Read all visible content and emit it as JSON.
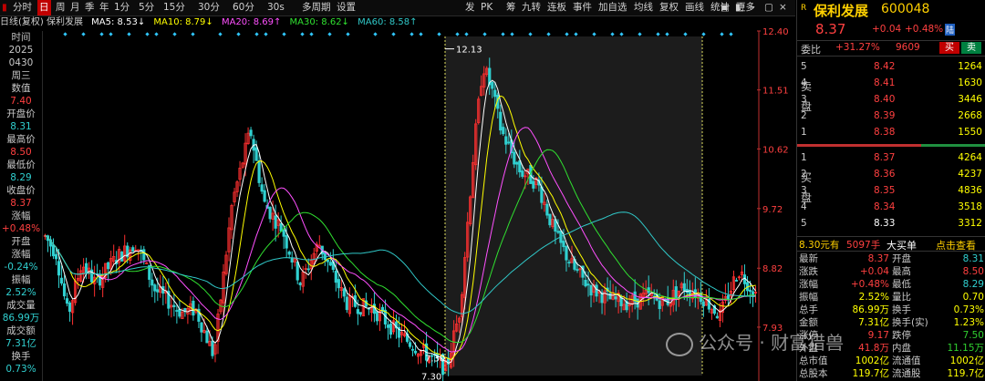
{
  "toolbar": {
    "tabs": [
      "分时",
      "日",
      "周",
      "月",
      "季",
      "年",
      "1分",
      "5分",
      "15分",
      "30分",
      "60分",
      "30s",
      "多周期",
      "设置"
    ],
    "active_tab": "日",
    "right_items": [
      "发",
      "PK",
      "筹",
      "九转",
      "连板",
      "事件",
      "加自选",
      "均线",
      "复权",
      "画线",
      "统计",
      "更多"
    ]
  },
  "info": {
    "stock_name": "日线(复权) 保利发展",
    "ma5": "MA5: 8.53↓",
    "ma10": "MA10: 8.79↓",
    "ma20": "MA20: 8.69↑",
    "ma30": "MA30: 8.62↓",
    "ma60": "MA60: 8.58↑"
  },
  "left_panel": [
    {
      "label": "时间",
      "color": "#c8c8c8"
    },
    {
      "label": "2025",
      "color": "#c8c8c8"
    },
    {
      "label": "0430",
      "color": "#c8c8c8"
    },
    {
      "label": "周三",
      "color": "#c8c8c8"
    },
    {
      "label": "数值",
      "color": "#c8c8c8"
    },
    {
      "label": "7.40",
      "color": "#ff4040"
    },
    {
      "label": "开盘价",
      "color": "#c8c8c8"
    },
    {
      "label": "8.31",
      "color": "#30d0d0"
    },
    {
      "label": "最高价",
      "color": "#c8c8c8"
    },
    {
      "label": "8.50",
      "color": "#ff4040"
    },
    {
      "label": "最低价",
      "color": "#c8c8c8"
    },
    {
      "label": "8.29",
      "color": "#30d0d0"
    },
    {
      "label": "收盘价",
      "color": "#c8c8c8"
    },
    {
      "label": "8.37",
      "color": "#ff4040"
    },
    {
      "label": "涨幅",
      "color": "#c8c8c8"
    },
    {
      "label": "+0.48%",
      "color": "#ff4040"
    },
    {
      "label": "开盘",
      "color": "#c8c8c8"
    },
    {
      "label": "涨幅",
      "color": "#c8c8c8"
    },
    {
      "label": "-0.24%",
      "color": "#30d0d0"
    },
    {
      "label": "振幅",
      "color": "#c8c8c8"
    },
    {
      "label": "2.52%",
      "color": "#30d0d0"
    },
    {
      "label": "成交量",
      "color": "#c8c8c8"
    },
    {
      "label": "86.99万",
      "color": "#30d0d0"
    },
    {
      "label": "成交额",
      "color": "#c8c8c8"
    },
    {
      "label": "7.31亿",
      "color": "#30d0d0"
    },
    {
      "label": "换手",
      "color": "#c8c8c8"
    },
    {
      "label": "0.73%",
      "color": "#30d0d0"
    }
  ],
  "chart_data": {
    "type": "candlestick",
    "y_ticks": [
      "12.40",
      "11.51",
      "10.62",
      "9.72",
      "8.82",
      "7.93"
    ],
    "annotations": {
      "high_label": "12.13",
      "low_label_1": "7.30",
      "low_label_2": "7.30"
    },
    "note": "daily candlestick chart with MA5/MA10/MA20/MA30/MA60 overlays"
  },
  "quote": {
    "badge": "R",
    "name": "保利发展",
    "code": "600048",
    "price": "8.37",
    "change": "+0.04",
    "change_pct": "+0.48%",
    "tag": "陆",
    "webi_label": "委比",
    "webi_value": "+31.27%",
    "webi_count": "9609",
    "buy_btn": "买",
    "sell_btn": "卖",
    "sell_side_label": [
      "卖",
      "盘"
    ],
    "buy_side_label": [
      "买",
      "盘"
    ],
    "asks": [
      {
        "lvl": "5",
        "price": "8.42",
        "vol": "1264"
      },
      {
        "lvl": "4",
        "price": "8.41",
        "vol": "1630"
      },
      {
        "lvl": "3",
        "price": "8.40",
        "vol": "3446"
      },
      {
        "lvl": "2",
        "price": "8.39",
        "vol": "2668"
      },
      {
        "lvl": "1",
        "price": "8.38",
        "vol": "1550"
      }
    ],
    "bids": [
      {
        "lvl": "1",
        "price": "8.37",
        "vol": "4264"
      },
      {
        "lvl": "2",
        "price": "8.36",
        "vol": "4237"
      },
      {
        "lvl": "3",
        "price": "8.35",
        "vol": "4836"
      },
      {
        "lvl": "4",
        "price": "8.34",
        "vol": "3518"
      },
      {
        "lvl": "5",
        "price": "8.33",
        "vol": "3312"
      }
    ],
    "big_order": {
      "price": "8.30元有",
      "qty": "5097手",
      "type": "大买单",
      "link": "点击查看"
    },
    "stats": [
      {
        "l1": "最新",
        "v1": "8.37",
        "c1": "#ff4040",
        "l2": "开盘",
        "v2": "8.31",
        "c2": "#30d0d0"
      },
      {
        "l1": "涨跌",
        "v1": "+0.04",
        "c1": "#ff4040",
        "l2": "最高",
        "v2": "8.50",
        "c2": "#ff4040"
      },
      {
        "l1": "涨幅",
        "v1": "+0.48%",
        "c1": "#ff4040",
        "l2": "最低",
        "v2": "8.29",
        "c2": "#30d0d0"
      },
      {
        "l1": "振幅",
        "v1": "2.52%",
        "c1": "#ffff00",
        "l2": "量比",
        "v2": "0.70",
        "c2": "#ffff00"
      },
      {
        "l1": "总手",
        "v1": "86.99万",
        "c1": "#ffff00",
        "l2": "换手",
        "v2": "0.73%",
        "c2": "#ffff00"
      },
      {
        "l1": "金额",
        "v1": "7.31亿",
        "c1": "#ffff00",
        "l2": "换手(实)",
        "v2": "1.23%",
        "c2": "#ffff00"
      },
      {
        "l1": "涨停",
        "v1": "9.17",
        "c1": "#ff4040",
        "l2": "跌停",
        "v2": "7.50",
        "c2": "#30d030"
      },
      {
        "l1": "外盘",
        "v1": "41.8万",
        "c1": "#ff4040",
        "l2": "内盘",
        "v2": "11.15万",
        "c2": "#30d030"
      },
      {
        "l1": "总市值",
        "v1": "1002亿",
        "c1": "#ffff00",
        "l2": "流通值",
        "v2": "1002亿",
        "c2": "#ffff00"
      },
      {
        "l1": "总股本",
        "v1": "119.7亿",
        "c1": "#ffff00",
        "l2": "流通股",
        "v2": "119.7亿",
        "c2": "#ffff00"
      }
    ]
  },
  "watermark": "公众号 · 财富猎兽"
}
